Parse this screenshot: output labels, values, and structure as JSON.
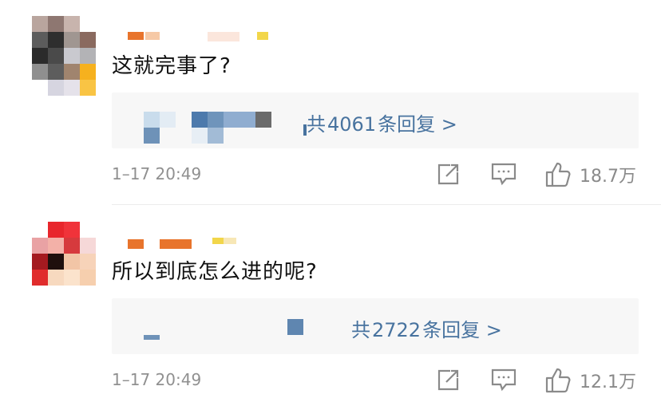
{
  "comments": [
    {
      "text": "这就完事了?",
      "reply_prefix": "共",
      "reply_count": "4061",
      "reply_suffix": "条回复 >",
      "time": "1–17 20:49",
      "likes": "18.7万"
    },
    {
      "text": "所以到底怎么进的呢?",
      "reply_prefix": "共",
      "reply_count": "2722",
      "reply_suffix": "条回复 >",
      "time": "1–17 20:49",
      "likes": "12.1万"
    }
  ],
  "icons": {
    "share": "share-icon",
    "comment": "comment-icon",
    "like": "thumbs-up-icon"
  },
  "colors": {
    "link": "#48739f",
    "meta": "#909090",
    "text": "#111111",
    "reply_bg": "#f7f7f7",
    "username_mosaic": "#e8742c"
  }
}
